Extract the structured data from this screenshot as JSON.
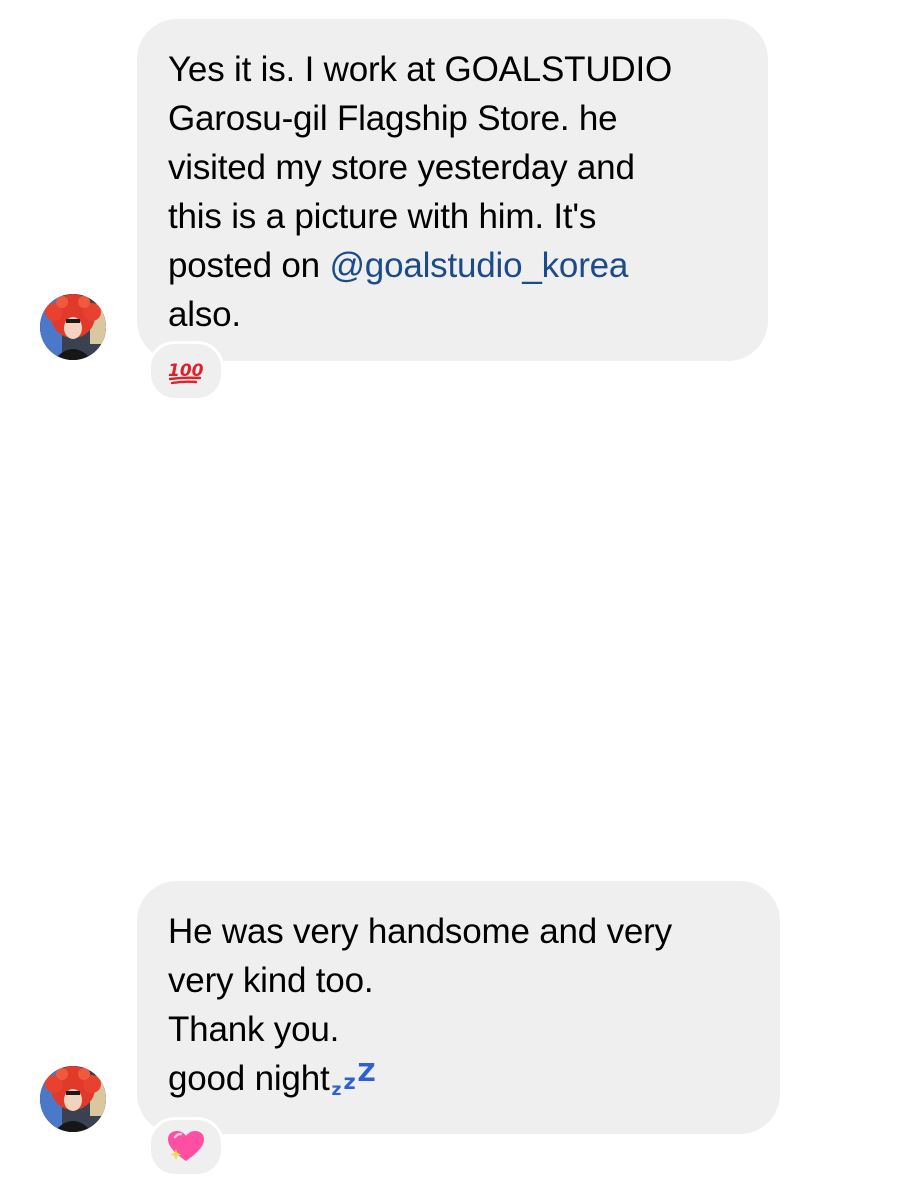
{
  "messages": [
    {
      "line1": "Yes it is. I work at GOALSTUDIO",
      "line2": "Garosu-gil Flagship Store. he",
      "line3": "visited my store yesterday and",
      "line4": "this is a picture with him. It's",
      "line5_prefix": "posted on ",
      "mention": "@goalstudio_korea",
      "line6": "also.",
      "reaction": "100-emoji"
    },
    {
      "line1": "He was very handsome and very",
      "line2": "very kind too.",
      "line3": "Thank you.",
      "line4": "good night",
      "sleep_glyph": "zzz",
      "reaction": "sparkling-heart-emoji"
    }
  ],
  "colors": {
    "bubble": "#efefef",
    "mention": "#1c4b8a",
    "zzz": "#2f5fd0",
    "heart": "#ff4fa3",
    "hundred": "#e0202a"
  }
}
